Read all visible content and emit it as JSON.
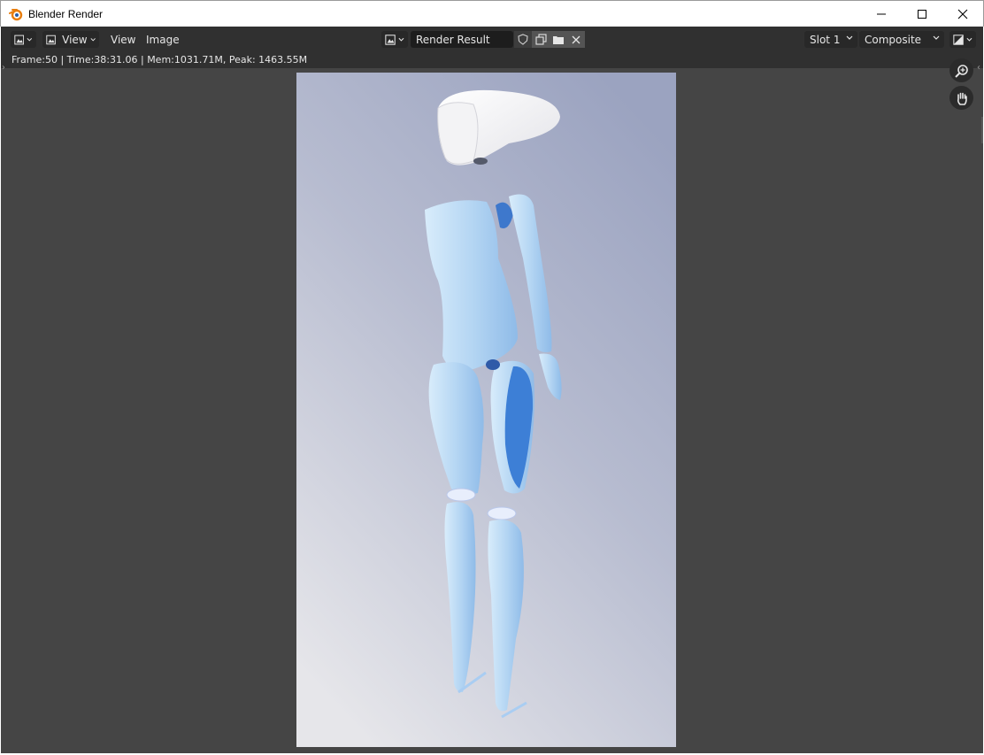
{
  "window": {
    "title": "Blender Render"
  },
  "header": {
    "editor_type_icon": "image-editor-icon",
    "view_menu_label": "View",
    "view_label": "View",
    "image_label": "Image",
    "image_name": "Render Result",
    "slot": "Slot 1",
    "layer": "Composite"
  },
  "status": {
    "text": "Frame:50 | Time:38:31.06 | Mem:1031.71M, Peak: 1463.55M"
  },
  "icons": {
    "app": "blender-logo-icon",
    "minimize": "minimize-icon",
    "maximize": "maximize-icon",
    "close": "close-icon",
    "zoom": "zoom-icon",
    "pan": "hand-pan-icon",
    "fake_user": "shield-icon",
    "duplicate": "duplicate-icon",
    "browse": "folder-icon",
    "unlink": "x-icon",
    "display_channels": "display-channels-icon"
  },
  "colors": {
    "editor_bg": "#454545",
    "header_bg": "#303030",
    "accent": "#e87d0d"
  }
}
